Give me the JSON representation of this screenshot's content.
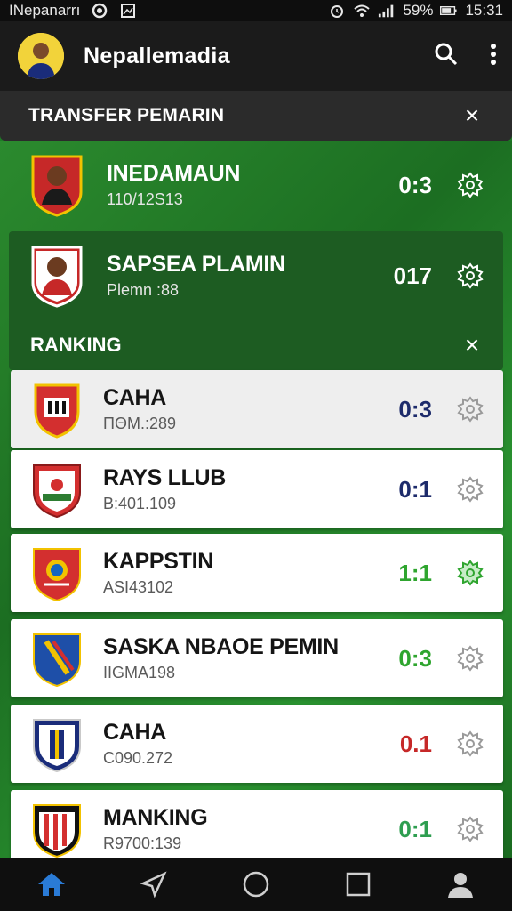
{
  "status_bar": {
    "carrier": "INepanarrı",
    "battery_pct": "59%",
    "time": "15:31",
    "icons": [
      "circle-icon",
      "image-icon",
      "alarm-icon",
      "wifi-icon",
      "signal-icon",
      "battery-icon"
    ]
  },
  "app_bar": {
    "title": "Nepallemadia",
    "icons": [
      "avatar",
      "search-icon",
      "more-vert-icon"
    ]
  },
  "transfer_header": {
    "title": "TRANSFER PEMARIN",
    "close": "×"
  },
  "top_items": [
    {
      "name": "INEDAMAUN",
      "sub": "110/12S13",
      "score": "0:3",
      "score_color": "#ffffff"
    },
    {
      "name": "SAPSEA PLAMIN",
      "sub": "Plemn :88",
      "score": "017",
      "score_color": "#ffffff"
    }
  ],
  "ranking_header": {
    "title": "RANKING",
    "close": "×"
  },
  "ranking_items": [
    {
      "name": "CAHA",
      "sub": "ΠΘΜ.:289",
      "score": "0:3",
      "score_color": "#1d2b6b",
      "gear_active": false
    },
    {
      "name": "RAYS LLUB",
      "sub": "B:401.109",
      "score": "0:1",
      "score_color": "#1d2b6b",
      "gear_active": false
    },
    {
      "name": "KAPPSTIN",
      "sub": "ASI43102",
      "score": "1:1",
      "score_color": "#2fa52f",
      "gear_active": true
    },
    {
      "name": "SASKA NBAOE PEMIN",
      "sub": "IIGMA198",
      "score": "0:3",
      "score_color": "#2fa52f",
      "gear_active": false
    },
    {
      "name": "CAHA",
      "sub": "C090.272",
      "score": "0.1",
      "score_color": "#c62828",
      "gear_active": false
    },
    {
      "name": "MANKING",
      "sub": "R9700:139",
      "score": "0:1",
      "score_color": "#2e9e50",
      "gear_active": false
    }
  ],
  "bottom_nav": [
    "home-icon",
    "send-icon",
    "circle-icon",
    "square-icon",
    "profile-icon"
  ],
  "colors": {
    "green": "#1f7a26",
    "dark_green_panel": "#1d5c22",
    "app_bar": "#1b1b1b",
    "nav_active": "#2a7bd6"
  }
}
